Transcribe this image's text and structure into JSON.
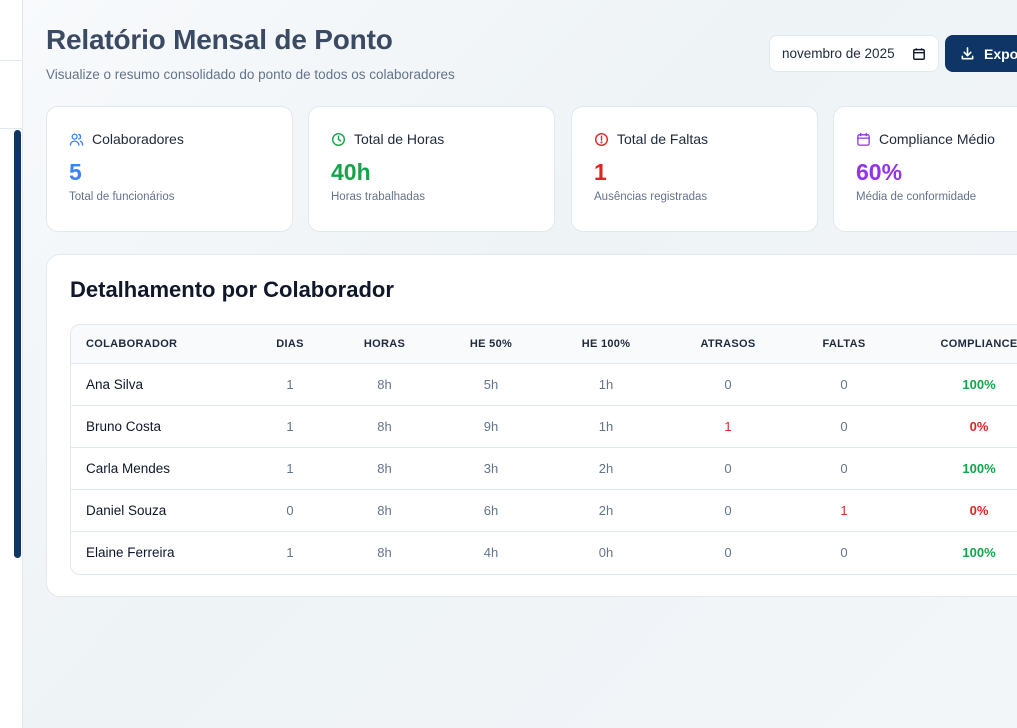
{
  "header": {
    "title": "Relatório Mensal de Ponto",
    "subtitle": "Visualize o resumo consolidado do ponto de todos os colaboradores",
    "month_value": "novembro de 2025",
    "export_label": "Expor"
  },
  "cards": [
    {
      "label": "Colaboradores",
      "value": "5",
      "caption": "Total de funcionários",
      "color": "#3b82f6",
      "icon": "users-icon"
    },
    {
      "label": "Total de Horas",
      "value": "40h",
      "caption": "Horas trabalhadas",
      "color": "#16a34a",
      "icon": "clock-icon"
    },
    {
      "label": "Total de Faltas",
      "value": "1",
      "caption": "Ausências registradas",
      "color": "#dc2626",
      "icon": "alert-circle-icon"
    },
    {
      "label": "Compliance Médio",
      "value": "60%",
      "caption": "Média de conformidade",
      "color": "#9333ea",
      "icon": "calendar-icon"
    }
  ],
  "detail": {
    "title": "Detalhamento por Colaborador",
    "columns": [
      "COLABORADOR",
      "DIAS",
      "HORAS",
      "HE 50%",
      "HE 100%",
      "ATRASOS",
      "FALTAS",
      "COMPLIANCE"
    ],
    "rows": [
      {
        "name": "Ana Silva",
        "dias": "1",
        "horas": "8h",
        "he50": "5h",
        "he100": "1h",
        "atrasos": "0",
        "faltas": "0",
        "compliance": "100%"
      },
      {
        "name": "Bruno Costa",
        "dias": "1",
        "horas": "8h",
        "he50": "9h",
        "he100": "1h",
        "atrasos": "1",
        "faltas": "0",
        "compliance": "0%"
      },
      {
        "name": "Carla Mendes",
        "dias": "1",
        "horas": "8h",
        "he50": "3h",
        "he100": "2h",
        "atrasos": "0",
        "faltas": "0",
        "compliance": "100%"
      },
      {
        "name": "Daniel Souza",
        "dias": "0",
        "horas": "8h",
        "he50": "6h",
        "he100": "2h",
        "atrasos": "0",
        "faltas": "1",
        "compliance": "0%"
      },
      {
        "name": "Elaine Ferreira",
        "dias": "1",
        "horas": "8h",
        "he50": "4h",
        "he100": "0h",
        "atrasos": "0",
        "faltas": "0",
        "compliance": "100%"
      }
    ]
  },
  "colors": {
    "primary": "#0f3566",
    "good": "#16a34a",
    "bad": "#dc2626"
  }
}
